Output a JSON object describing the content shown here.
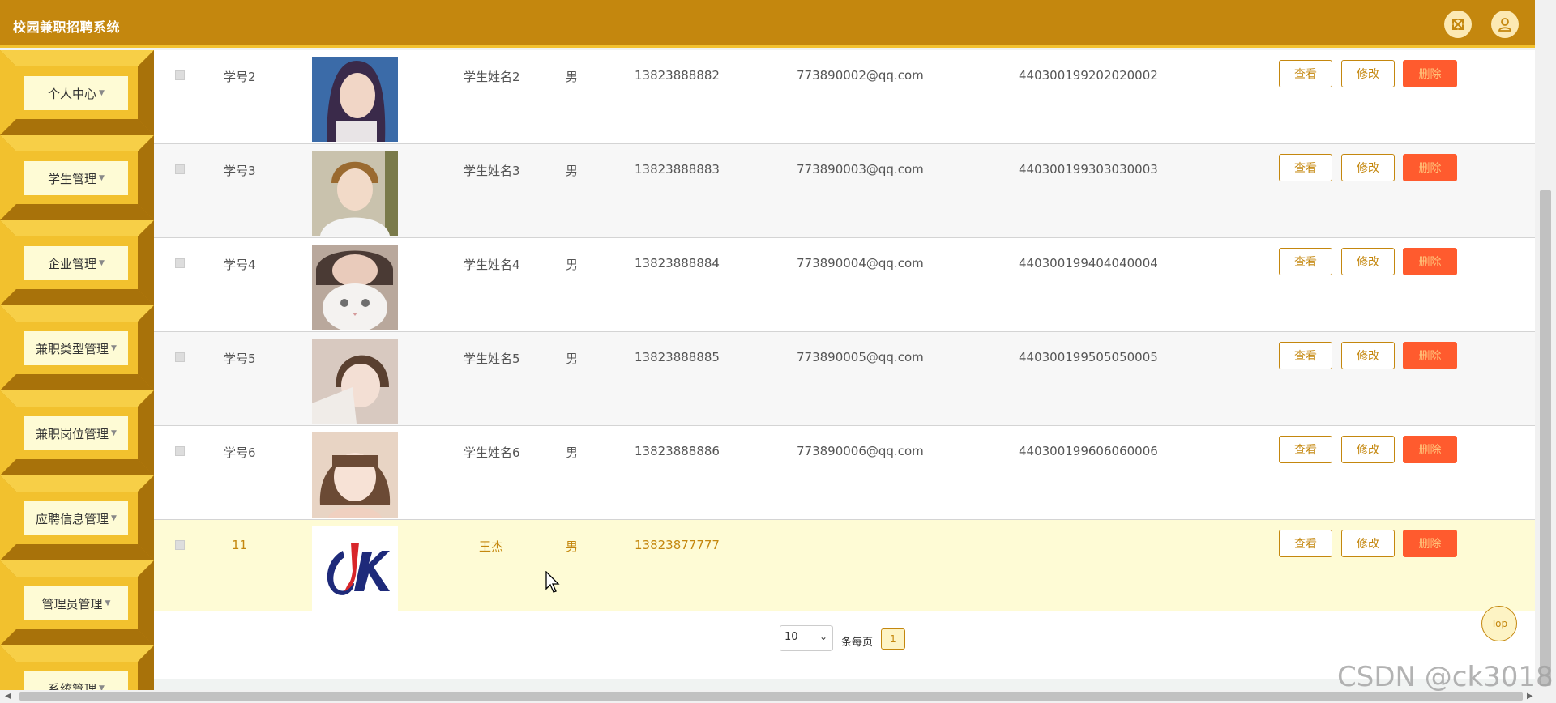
{
  "app": {
    "title": "校园兼职招聘系统"
  },
  "header": {
    "fullscreen_icon": "expand-icon",
    "user_icon": "user-icon"
  },
  "sidebar": {
    "items": [
      {
        "label": "个人中心"
      },
      {
        "label": "学生管理"
      },
      {
        "label": "企业管理"
      },
      {
        "label": "兼职类型管理"
      },
      {
        "label": "兼职岗位管理"
      },
      {
        "label": "应聘信息管理"
      },
      {
        "label": "管理员管理"
      },
      {
        "label": "系统管理"
      }
    ]
  },
  "table": {
    "rows": [
      {
        "id": "学号2",
        "name": "学生姓名2",
        "gender": "男",
        "phone": "13823888882",
        "email": "773890002@qq.com",
        "idcard": "440300199202020002"
      },
      {
        "id": "学号3",
        "name": "学生姓名3",
        "gender": "男",
        "phone": "13823888883",
        "email": "773890003@qq.com",
        "idcard": "440300199303030003"
      },
      {
        "id": "学号4",
        "name": "学生姓名4",
        "gender": "男",
        "phone": "13823888884",
        "email": "773890004@qq.com",
        "idcard": "440300199404040004"
      },
      {
        "id": "学号5",
        "name": "学生姓名5",
        "gender": "男",
        "phone": "13823888885",
        "email": "773890005@qq.com",
        "idcard": "440300199505050005"
      },
      {
        "id": "学号6",
        "name": "学生姓名6",
        "gender": "男",
        "phone": "13823888886",
        "email": "773890006@qq.com",
        "idcard": "440300199606060006"
      },
      {
        "id": "11",
        "name": "王杰",
        "gender": "男",
        "phone": "13823877777",
        "email": "",
        "idcard": ""
      }
    ],
    "actions": {
      "view": "查看",
      "edit": "修改",
      "delete": "删除"
    }
  },
  "pagination": {
    "page_size": "10",
    "per_page_label": "条每页",
    "current_page": "1",
    "top_label": "Top"
  },
  "watermark": "CSDN @ck3018",
  "colors": {
    "primary": "#c4870e",
    "menu_bg": "#f2c12e",
    "highlight_row": "#fefbd5",
    "delete": "#ff5b2e"
  }
}
